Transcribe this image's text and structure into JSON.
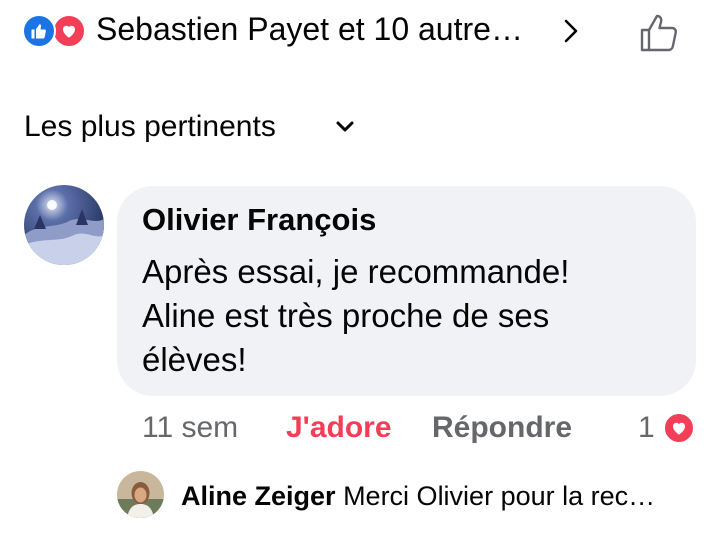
{
  "reactions": {
    "summary": "Sebastien Payet et 10 autre…",
    "like_color": "#1b74e4",
    "love_color": "#f33e58"
  },
  "sort": {
    "label": "Les plus pertinents"
  },
  "comment": {
    "author": "Olivier François",
    "lines": [
      "Après essai, je recommande!",
      "Aline est très proche de ses",
      "élèves!"
    ],
    "time": "11 sem",
    "reaction_label": "J'adore",
    "reply_label": "Répondre",
    "reaction_count": "1"
  },
  "reply_preview": {
    "author": "Aline Zeiger",
    "text": "Merci Olivier pour la rec…"
  }
}
